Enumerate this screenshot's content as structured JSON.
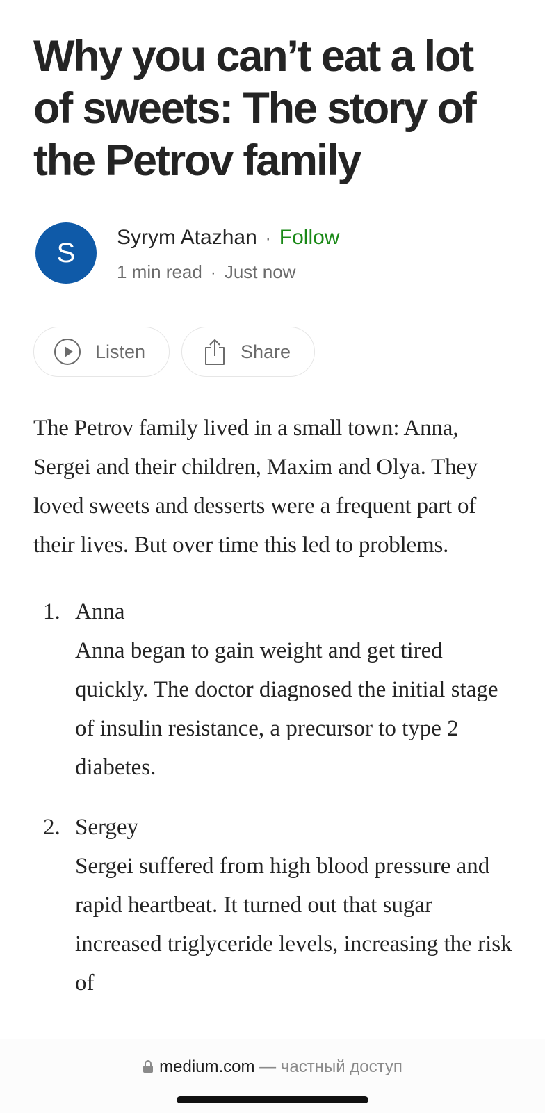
{
  "article": {
    "title": "Why you can’t eat a lot of sweets: The story of the Petrov family",
    "author": {
      "avatar_letter": "S",
      "avatar_color": "#0f5aa8",
      "name": "Syrym Atazhan",
      "follow_label": "Follow",
      "read_time": "1 min read",
      "published": "Just now"
    },
    "actions": {
      "listen_label": "Listen",
      "share_label": "Share"
    },
    "intro": "The Petrov family lived in a small town: Anna, Sergei and their children, Maxim and Olya. They loved sweets and desserts were a frequent part of their lives. But over time this led to problems.",
    "items": [
      {
        "number": "1.",
        "heading": "Anna",
        "text": "Anna began to gain weight and get tired quickly. The doctor diagnosed the initial stage of insulin resistance, a precursor to type 2 diabetes."
      },
      {
        "number": "2.",
        "heading": "Sergey",
        "text": "Sergei suffered from high blood pressure and rapid heartbeat. It turned out that sugar increased triglyceride levels, increasing the risk of"
      }
    ]
  },
  "browser": {
    "domain": "medium.com",
    "private_label": "— частный доступ"
  },
  "colors": {
    "accent_follow": "#1a8917",
    "text": "#242424",
    "muted": "#6b6b6b"
  }
}
